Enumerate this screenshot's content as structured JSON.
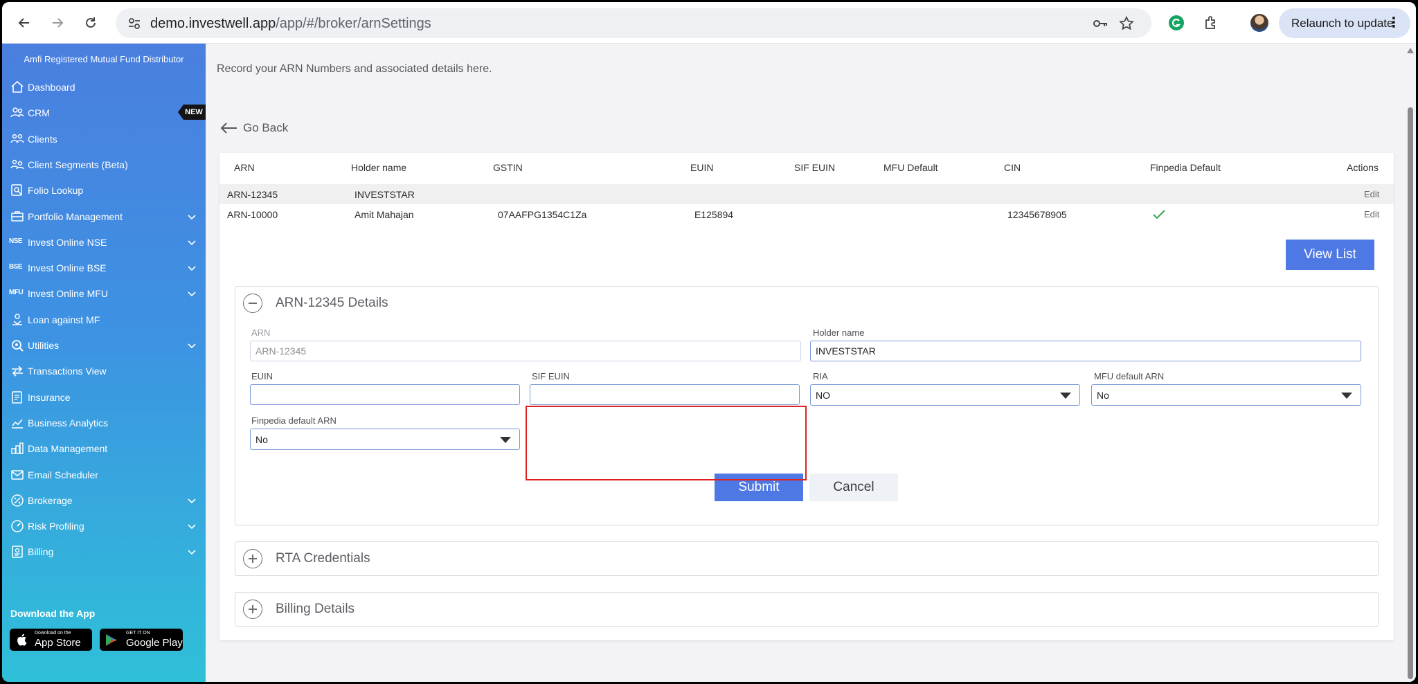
{
  "browser": {
    "url_host": "demo.investwell.app",
    "url_path": "/app/#/broker/arnSettings",
    "relaunch_label": "Relaunch to update"
  },
  "sidebar": {
    "title": "Amfi Registered Mutual Fund Distributor",
    "new_badge": "NEW",
    "items": [
      {
        "label": "Dashboard",
        "icon": "home-icon",
        "chevron": false
      },
      {
        "label": "CRM",
        "icon": "people-icon",
        "chevron": false
      },
      {
        "label": "Clients",
        "icon": "clients-icon",
        "chevron": false
      },
      {
        "label": "Client Segments (Beta)",
        "icon": "segments-icon",
        "chevron": false
      },
      {
        "label": "Folio Lookup",
        "icon": "folio-icon",
        "chevron": false
      },
      {
        "label": "Portfolio Management",
        "icon": "briefcase-icon",
        "chevron": true
      },
      {
        "label": "Invest Online NSE",
        "tag": "NSE",
        "chevron": true
      },
      {
        "label": "Invest Online BSE",
        "tag": "BSE",
        "chevron": true
      },
      {
        "label": "Invest Online MFU",
        "tag": "MFU",
        "chevron": true
      },
      {
        "label": "Loan against MF",
        "icon": "loan-icon",
        "chevron": false
      },
      {
        "label": "Utilities",
        "icon": "utilities-icon",
        "chevron": true
      },
      {
        "label": "Transactions View",
        "icon": "transfer-icon",
        "chevron": false
      },
      {
        "label": "Insurance",
        "icon": "insurance-icon",
        "chevron": false
      },
      {
        "label": "Business Analytics",
        "icon": "analytics-icon",
        "chevron": false
      },
      {
        "label": "Data Management",
        "icon": "data-icon",
        "chevron": false
      },
      {
        "label": "Email Scheduler",
        "icon": "email-icon",
        "chevron": false
      },
      {
        "label": "Brokerage",
        "icon": "percent-icon",
        "chevron": true
      },
      {
        "label": "Risk Profiling",
        "icon": "gauge-icon",
        "chevron": true
      },
      {
        "label": "Billing",
        "icon": "billing-icon",
        "chevron": true
      }
    ],
    "download_title": "Download the App",
    "app_store_small": "Download on the",
    "app_store_big": "App Store",
    "google_play_small": "GET IT ON",
    "google_play_big": "Google Play"
  },
  "main": {
    "intro": "Record your ARN Numbers and associated details here.",
    "go_back": "Go Back",
    "table": {
      "headers": [
        "ARN",
        "Holder name",
        "GSTIN",
        "EUIN",
        "SIF EUIN",
        "MFU Default",
        "CIN",
        "Finpedia Default",
        "Actions"
      ],
      "rows": [
        {
          "arn": "ARN-12345",
          "holder": "INVESTSTAR",
          "gstin": "",
          "euin": "",
          "sif_euin": "",
          "mfu_default": "",
          "cin": "",
          "finpedia_default": false,
          "action": "Edit"
        },
        {
          "arn": "ARN-10000",
          "holder": "Amit Mahajan",
          "gstin": "07AAFPG1354C1Za",
          "euin": "E125894",
          "sif_euin": "",
          "mfu_default": "",
          "cin": "12345678905",
          "finpedia_default": true,
          "action": "Edit"
        }
      ]
    },
    "view_list": "View List",
    "details_panel": {
      "title": "ARN-12345 Details",
      "arn_label": "ARN",
      "arn_value": "ARN-12345",
      "holder_label": "Holder name",
      "holder_value": "INVESTSTAR",
      "euin_label": "EUIN",
      "euin_value": "",
      "sif_euin_label": "SIF EUIN",
      "sif_euin_value": "",
      "ria_label": "RIA",
      "ria_value": "NO",
      "mfu_label": "MFU default ARN",
      "mfu_value": "No",
      "finpedia_label": "Finpedia default ARN",
      "finpedia_value": "No",
      "submit": "Submit",
      "cancel": "Cancel"
    },
    "rta_panel_title": "RTA Credentials",
    "billing_panel_title": "Billing Details"
  },
  "colors": {
    "accent": "#4e79e4",
    "highlight": "#e02020",
    "check": "#2fa84f"
  }
}
